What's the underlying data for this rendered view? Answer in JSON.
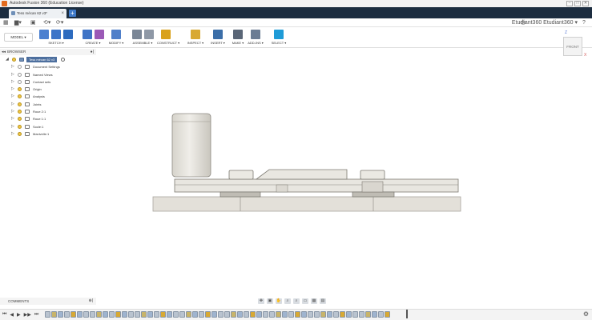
{
  "window": {
    "title": "Autodesk Fusion 360 (Education License)",
    "controls": [
      "–",
      "□",
      "✕"
    ]
  },
  "tab": {
    "label": "Tess mécan 62 v3*"
  },
  "qat": {
    "user": "Etudiant360 Etudiant360 ▾"
  },
  "ribbon": {
    "workspace": "MODEL ▾",
    "groups": [
      {
        "label": "SKETCH ▾",
        "colors": [
          "#4a7fd0",
          "#3c74c8",
          "#2d6bbf"
        ]
      },
      {
        "label": "CREATE ▾",
        "colors": [
          "#3f74c6",
          "#9b59b6"
        ]
      },
      {
        "label": "MODIFY ▾",
        "colors": [
          "#4f7fc9"
        ]
      },
      {
        "label": "ASSEMBLE ▾",
        "colors": [
          "#7a8696",
          "#8e98a6"
        ]
      },
      {
        "label": "CONSTRUCT ▾",
        "colors": [
          "#d9a21b"
        ]
      },
      {
        "label": "INSPECT ▾",
        "colors": [
          "#d8a933"
        ]
      },
      {
        "label": "INSERT ▾",
        "colors": [
          "#3b6ea8"
        ]
      },
      {
        "label": "MAKE ▾",
        "colors": [
          "#5a6677"
        ]
      },
      {
        "label": "ADD-INS ▾",
        "colors": [
          "#6b7c93"
        ]
      },
      {
        "label": "SELECT ▾",
        "colors": [
          "#1f9bd7"
        ]
      }
    ]
  },
  "browser": {
    "title": "BROWSER",
    "root": "Tess mécan 62 v3",
    "items": [
      {
        "label": "Document Settings",
        "bulb": false
      },
      {
        "label": "Named Views",
        "bulb": false
      },
      {
        "label": "Contact sets",
        "bulb": false
      },
      {
        "label": "Origin",
        "bulb": true
      },
      {
        "label": "Analysis",
        "bulb": true
      },
      {
        "label": "Joints",
        "bulb": true
      },
      {
        "label": "Roue 2:1",
        "bulb": true
      },
      {
        "label": "Roue 1:1",
        "bulb": true
      },
      {
        "label": "Socle:1",
        "bulb": true
      },
      {
        "label": "Manivelle:1",
        "bulb": true
      }
    ]
  },
  "viewcube": {
    "face": "FRONT",
    "z": "Z",
    "x": "X"
  },
  "comments": {
    "title": "COMMENTS"
  },
  "colors": {
    "accent": "#1f9bd7",
    "tabbar": "#1c2d40",
    "part": "#e6e3dc"
  }
}
